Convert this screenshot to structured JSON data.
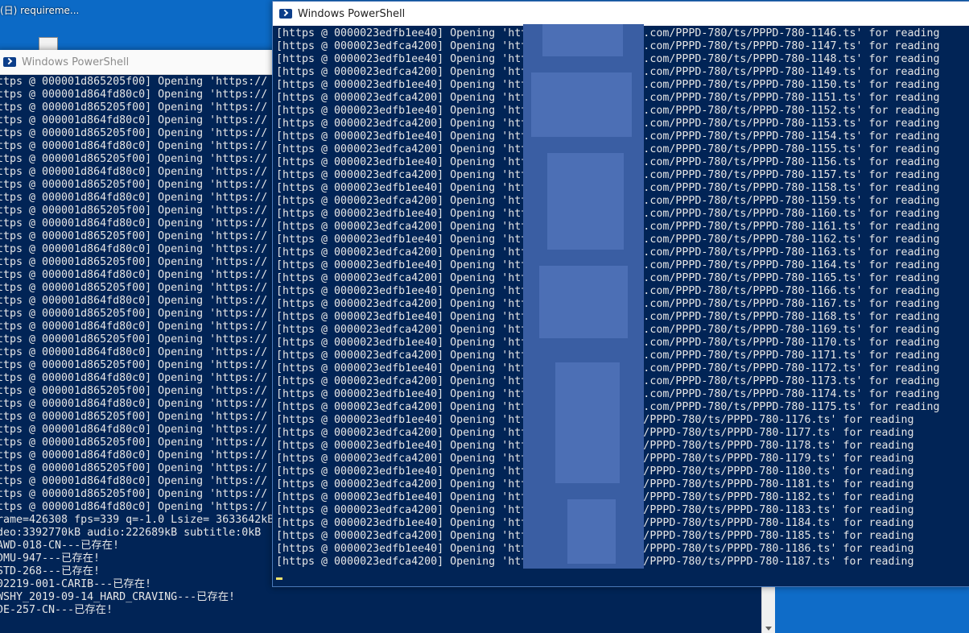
{
  "desktop": {
    "top_label": "(日) requireme..."
  },
  "back_window": {
    "title": "Windows PowerShell",
    "lines": [
      "ttps @ 000001d865205f00] Opening 'https://",
      "ttps @ 000001d864fd80c0] Opening 'https://",
      "ttps @ 000001d865205f00] Opening 'https://",
      "ttps @ 000001d864fd80c0] Opening 'https://",
      "ttps @ 000001d865205f00] Opening 'https://",
      "ttps @ 000001d864fd80c0] Opening 'https://",
      "ttps @ 000001d865205f00] Opening 'https://",
      "ttps @ 000001d864fd80c0] Opening 'https://",
      "ttps @ 000001d865205f00] Opening 'https://",
      "ttps @ 000001d864fd80c0] Opening 'https://",
      "ttps @ 000001d865205f00] Opening 'https://",
      "ttps @ 000001d864fd80c0] Opening 'https://",
      "ttps @ 000001d865205f00] Opening 'https://",
      "ttps @ 000001d864fd80c0] Opening 'https://",
      "ttps @ 000001d865205f00] Opening 'https://",
      "ttps @ 000001d864fd80c0] Opening 'https://",
      "ttps @ 000001d865205f00] Opening 'https://",
      "ttps @ 000001d864fd80c0] Opening 'https://",
      "ttps @ 000001d865205f00] Opening 'https://",
      "ttps @ 000001d864fd80c0] Opening 'https://",
      "ttps @ 000001d865205f00] Opening 'https://",
      "ttps @ 000001d864fd80c0] Opening 'https://",
      "ttps @ 000001d865205f00] Opening 'https://",
      "ttps @ 000001d864fd80c0] Opening 'https://",
      "ttps @ 000001d865205f00] Opening 'https://",
      "ttps @ 000001d864fd80c0] Opening 'https://",
      "ttps @ 000001d865205f00] Opening 'https://",
      "ttps @ 000001d864fd80c0] Opening 'https://",
      "ttps @ 000001d865205f00] Opening 'https://",
      "ttps @ 000001d864fd80c0] Opening 'https://",
      "ttps @ 000001d865205f00] Opening 'https://",
      "ttps @ 000001d864fd80c0] Opening 'https://",
      "ttps @ 000001d865205f00] Opening 'https://",
      "ttps @ 000001d864fd80c0] Opening 'https://",
      "rame=426308 fps=339 q=-1.0 Lsize= 3633642kB",
      "deo:3392770kB audio:222689kB subtitle:0kB",
      "AWD-018-CN---已存在!",
      "DMU-947---已存在!",
      "STD-268---已存在!",
      "02219-001-CARIB---已存在!",
      "WSHY_2019-09-14_HARD_CRAVING---已存在!",
      "DE-257-CN---已存在!"
    ]
  },
  "front_window": {
    "title": "Windows PowerShell",
    "lines": [
      "[https @ 0000023edfb1ee40] Opening 'https://             .com/PPPD-780/ts/PPPD-780-1146.ts' for reading",
      "[https @ 0000023edfca4200] Opening 'https://             .com/PPPD-780/ts/PPPD-780-1147.ts' for reading",
      "[https @ 0000023edfb1ee40] Opening 'https://             .com/PPPD-780/ts/PPPD-780-1148.ts' for reading",
      "[https @ 0000023edfca4200] Opening 'https://             .com/PPPD-780/ts/PPPD-780-1149.ts' for reading",
      "[https @ 0000023edfb1ee40] Opening 'https://             .com/PPPD-780/ts/PPPD-780-1150.ts' for reading",
      "[https @ 0000023edfca4200] Opening 'https://             .com/PPPD-780/ts/PPPD-780-1151.ts' for reading",
      "[https @ 0000023edfb1ee40] Opening 'https://             .com/PPPD-780/ts/PPPD-780-1152.ts' for reading",
      "[https @ 0000023edfca4200] Opening 'https://             .com/PPPD-780/ts/PPPD-780-1153.ts' for reading",
      "[https @ 0000023edfb1ee40] Opening 'https://             .com/PPPD-780/ts/PPPD-780-1154.ts' for reading",
      "[https @ 0000023edfca4200] Opening 'https://             .com/PPPD-780/ts/PPPD-780-1155.ts' for reading",
      "[https @ 0000023edfb1ee40] Opening 'https://             .com/PPPD-780/ts/PPPD-780-1156.ts' for reading",
      "[https @ 0000023edfca4200] Opening 'https://             .com/PPPD-780/ts/PPPD-780-1157.ts' for reading",
      "[https @ 0000023edfb1ee40] Opening 'https://             .com/PPPD-780/ts/PPPD-780-1158.ts' for reading",
      "[https @ 0000023edfca4200] Opening 'https://             .com/PPPD-780/ts/PPPD-780-1159.ts' for reading",
      "[https @ 0000023edfb1ee40] Opening 'https://             .com/PPPD-780/ts/PPPD-780-1160.ts' for reading",
      "[https @ 0000023edfca4200] Opening 'https://             .com/PPPD-780/ts/PPPD-780-1161.ts' for reading",
      "[https @ 0000023edfb1ee40] Opening 'https://             .com/PPPD-780/ts/PPPD-780-1162.ts' for reading",
      "[https @ 0000023edfca4200] Opening 'https://             .com/PPPD-780/ts/PPPD-780-1163.ts' for reading",
      "[https @ 0000023edfb1ee40] Opening 'https://             .com/PPPD-780/ts/PPPD-780-1164.ts' for reading",
      "[https @ 0000023edfca4200] Opening 'https://             .com/PPPD-780/ts/PPPD-780-1165.ts' for reading",
      "[https @ 0000023edfb1ee40] Opening 'https://             .com/PPPD-780/ts/PPPD-780-1166.ts' for reading",
      "[https @ 0000023edfca4200] Opening 'https://             .com/PPPD-780/ts/PPPD-780-1167.ts' for reading",
      "[https @ 0000023edfb1ee40] Opening 'https://             .com/PPPD-780/ts/PPPD-780-1168.ts' for reading",
      "[https @ 0000023edfca4200] Opening 'https://             .com/PPPD-780/ts/PPPD-780-1169.ts' for reading",
      "[https @ 0000023edfb1ee40] Opening 'https://             .com/PPPD-780/ts/PPPD-780-1170.ts' for reading",
      "[https @ 0000023edfca4200] Opening 'https://             .com/PPPD-780/ts/PPPD-780-1171.ts' for reading",
      "[https @ 0000023edfb1ee40] Opening 'https://             .com/PPPD-780/ts/PPPD-780-1172.ts' for reading",
      "[https @ 0000023edfca4200] Opening 'https://             .com/PPPD-780/ts/PPPD-780-1173.ts' for reading",
      "[https @ 0000023edfb1ee40] Opening 'https://             .com/PPPD-780/ts/PPPD-780-1174.ts' for reading",
      "[https @ 0000023edfca4200] Opening 'https://             .com/PPPD-780/ts/PPPD-780-1175.ts' for reading",
      "[https @ 0000023edfb1ee40] Opening 'https://sat         m/PPPD-780/ts/PPPD-780-1176.ts' for reading",
      "[https @ 0000023edfca4200] Opening 'https://sat         m/PPPD-780/ts/PPPD-780-1177.ts' for reading",
      "[https @ 0000023edfb1ee40] Opening 'https://sat         m/PPPD-780/ts/PPPD-780-1178.ts' for reading",
      "[https @ 0000023edfca4200] Opening 'https://sat         m/PPPD-780/ts/PPPD-780-1179.ts' for reading",
      "[https @ 0000023edfb1ee40] Opening 'https://sat         m/PPPD-780/ts/PPPD-780-1180.ts' for reading",
      "[https @ 0000023edfca4200] Opening 'https://sat         m/PPPD-780/ts/PPPD-780-1181.ts' for reading",
      "[https @ 0000023edfb1ee40] Opening 'https://sat         m/PPPD-780/ts/PPPD-780-1182.ts' for reading",
      "[https @ 0000023edfca4200] Opening 'https://sat  v1     m/PPPD-780/ts/PPPD-780-1183.ts' for reading",
      "[https @ 0000023edfb1ee40] Opening 'https://sat  v1     m/PPPD-780/ts/PPPD-780-1184.ts' for reading",
      "[https @ 0000023edfca4200] Opening 'https://sat  v1     m/PPPD-780/ts/PPPD-780-1185.ts' for reading",
      "[https @ 0000023edfb1ee40] Opening 'https://sa   v1     m/PPPD-780/ts/PPPD-780-1186.ts' for reading",
      "[https @ 0000023edfca4200] Opening 'https://sa   v1     m/PPPD-780/ts/PPPD-780-1187.ts' for reading"
    ]
  }
}
